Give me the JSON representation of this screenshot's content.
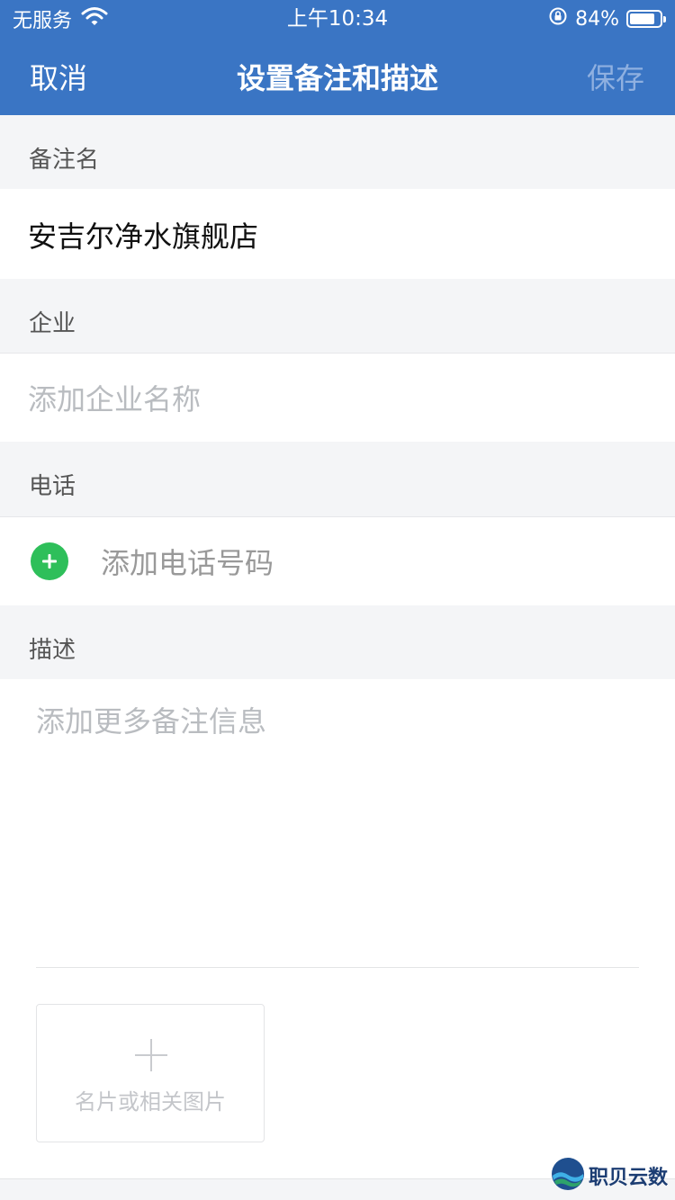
{
  "status_bar": {
    "carrier": "无服务",
    "time": "上午10:34",
    "battery_percent": "84%",
    "battery_level": 0.84
  },
  "nav": {
    "cancel_label": "取消",
    "title": "设置备注和描述",
    "save_label": "保存"
  },
  "remark": {
    "label": "备注名",
    "value": "安吉尔净水旗舰店"
  },
  "company": {
    "label": "企业",
    "placeholder": "添加企业名称"
  },
  "phone": {
    "label": "电话",
    "add_label": "添加电话号码"
  },
  "description": {
    "label": "描述",
    "placeholder": "添加更多备注信息",
    "photo_label": "名片或相关图片"
  },
  "watermark": {
    "text": "职贝云数"
  },
  "colors": {
    "header_bg": "#3a75c4",
    "add_green": "#2ebf5a",
    "section_bg": "#f4f5f7"
  },
  "icons": [
    "wifi-icon",
    "rotation-lock-icon",
    "battery-icon",
    "add-phone-icon",
    "add-photo-icon",
    "watermark-logo-icon"
  ]
}
